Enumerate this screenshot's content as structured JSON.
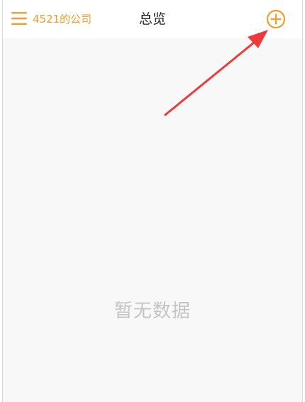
{
  "header": {
    "company_name": "4521的公司",
    "title": "总览"
  },
  "content": {
    "empty_message": "暂无数据"
  },
  "icons": {
    "menu": "menu-icon",
    "add": "plus-circle-icon"
  },
  "colors": {
    "accent": "#f39c2b",
    "annotation": "#f03a3a",
    "empty_text": "#c4c4c4",
    "content_bg": "#f8f8f8"
  }
}
